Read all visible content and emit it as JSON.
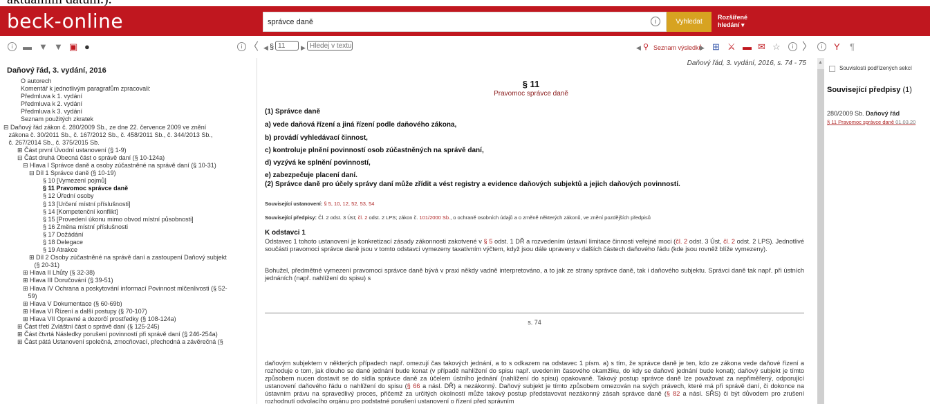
{
  "top_crop_text": "aktuálním datům.).",
  "header": {
    "logo": "beck-online",
    "search_value": "správce daně",
    "search_info": "i",
    "search_button": "Vyhledat",
    "advanced_line1": "Rozšířené",
    "advanced_line2": "hledání ▾"
  },
  "toolbar": {
    "left_icons": [
      "i",
      "▬",
      "▼",
      "▼",
      "▣",
      "●"
    ],
    "info": "i",
    "collapse": "〈",
    "prev": "◀",
    "section_symbol": "§",
    "section_input": "11",
    "next": "▶",
    "find_placeholder": "Hledej v textu",
    "result_prev": "◀",
    "results_label": "Seznam výsledků",
    "result_next": "▶",
    "right_icons": [
      "⊞",
      "⚔",
      "▬",
      "✉",
      "☆",
      "i"
    ],
    "expand": "〉",
    "right_info": "i",
    "filter": "Y",
    "bookmark": "¶"
  },
  "left": {
    "title": "Daňový řád, 3. vydání, 2016",
    "items": [
      {
        "indent": 0,
        "text": "O autorech"
      },
      {
        "indent": 0,
        "text": "Komentář k jednotlivým paragrafům zpracovali:"
      },
      {
        "indent": 0,
        "text": "Předmluva k 1. vydání"
      },
      {
        "indent": 0,
        "text": "Předmluva k 2. vydání"
      },
      {
        "indent": 0,
        "text": "Předmluva k 3. vydání"
      },
      {
        "indent": 0,
        "text": "Seznam použitých zkratek"
      },
      {
        "indent": -1,
        "text": "⊟ Daňový řád zákon č. 280/2009 Sb., ze dne 22. července 2009 ve znění\n   zákona č. 30/2011 Sb., č. 167/2012 Sb., č. 458/2011 Sb., č. 344/2013 Sb.,\n   č. 267/2014 Sb., č. 375/2015 Sb."
      },
      {
        "indent": 1,
        "text": "⊞ Část první Úvodní ustanovení (§ 1-9)"
      },
      {
        "indent": 1,
        "text": "⊟ Část druhá Obecná část o správě daní (§ 10-124a)"
      },
      {
        "indent": 2,
        "text": "⊟ Hlava I Správce daně a osoby zúčastněné na správě daní (§ 10-31)"
      },
      {
        "indent": 3,
        "text": "⊟ Díl 1 Správce daně (§ 10-19)"
      },
      {
        "indent": 4,
        "text": "§ 10 [Vymezení pojmů]"
      },
      {
        "indent": 4,
        "text": "§ 11 Pravomoc správce daně",
        "bold": true
      },
      {
        "indent": 4,
        "text": "§ 12 Úřední osoby"
      },
      {
        "indent": 4,
        "text": "§ 13 [Určení místní příslušnosti]"
      },
      {
        "indent": 4,
        "text": "§ 14 [Kompetenční konflikt]"
      },
      {
        "indent": 4,
        "text": "§ 15 [Provedení úkonu mimo obvod místní působnosti]"
      },
      {
        "indent": 4,
        "text": "§ 16 Změna místní příslušnosti"
      },
      {
        "indent": 4,
        "text": "§ 17 Dožádání"
      },
      {
        "indent": 4,
        "text": "§ 18 Delegace"
      },
      {
        "indent": 4,
        "text": "§ 19 Atrakce"
      },
      {
        "indent": 3,
        "text": "⊞ Díl 2 Osoby zúčastněné na správě daní a zastoupení Daňový subjekt\n   (§ 20-31)"
      },
      {
        "indent": 2,
        "text": "⊞ Hlava II Lhůty (§ 32-38)"
      },
      {
        "indent": 2,
        "text": "⊞ Hlava III Doručování (§ 39-51)"
      },
      {
        "indent": 2,
        "text": "⊞ Hlava IV Ochrana a poskytování informací Povinnost mlčenlivosti (§ 52-\n   59)"
      },
      {
        "indent": 2,
        "text": "⊞ Hlava V Dokumentace (§ 60-69b)"
      },
      {
        "indent": 2,
        "text": "⊞ Hlava VI Řízení a další postupy (§ 70-107)"
      },
      {
        "indent": 2,
        "text": "⊞ Hlava VII Opravné a dozorčí prostředky (§ 108-124a)"
      },
      {
        "indent": 1,
        "text": "⊞ Část třetí Zvláštní část o správě daní (§ 125-245)"
      },
      {
        "indent": 1,
        "text": "⊞ Část čtvrtá Následky porušení povinností při správě daní (§ 246-254a)"
      },
      {
        "indent": 1,
        "text": "⊞ Část pátá Ustanovení společná, zmocňovací, přechodná a závěrečná (§"
      }
    ]
  },
  "main": {
    "citation": "Daňový řád, 3. vydání, 2016, s. 74 - 75",
    "section_title": "§ 11",
    "section_subtitle": "Pravomoc správce daně",
    "paragraph1_heading": "(1) Správce daně",
    "points": [
      "a)   vede daňová řízení a jiná řízení podle daňového zákona,",
      "b)   provádí vyhledávací činnost,",
      "c)   kontroluje plnění povinností osob zúčastněných na správě daní,",
      "d)   vyzývá ke splnění povinností,",
      "e)   zabezpečuje placení daní."
    ],
    "paragraph2": "(2) Správce daně pro účely správy daní může zřídit a vést registry a evidence daňových subjektů a jejich daňových povinností.",
    "related_provisions_label": "Související ustanovení:",
    "related_provisions_links": "§ 5, 10, 12, 52, 53, 54",
    "related_regs_label": "Související předpisy:",
    "related_regs_t1": "Čl. 2 odst. 3 Úst;",
    "related_regs_l1": "čl. 2",
    "related_regs_t2": "odst. 2 LPS; zákon č.",
    "related_regs_l2": "101/2000 Sb.",
    "related_regs_t3": ", o ochraně osobních údajů a o změně některých zákonů, ve znění pozdějších předpisů",
    "k_odstavci_title": "K odstavci 1",
    "body1_a": "Odstavec 1 tohoto ustanovení je konkretizací zásady zákonnosti zakotvené v",
    "body1_l1": "§ 5",
    "body1_b": "odst. 1 DŘ a rozvedením ústavní limitace činnosti veřejné moci (",
    "body1_l2": "čl. 2",
    "body1_c": "odst. 3 Úst,",
    "body1_l3": "čl. 2",
    "body1_d": "odst. 2 LPS). Jednotlivé součásti pravomoci správce daně jsou v tomto odstavci vymezeny taxativním výčtem, když jsou dále upraveny v dalších částech daňového řádu (kde jsou rovněž blíže vymezeny).",
    "body2": "Bohužel, předmětné vymezení pravomoci správce daně bývá v praxi někdy vadně interpretováno, a to jak ze strany správce daně, tak i daňového subjektu. Správci daně tak např. při ústních jednáních (např. nahlížení do spisu) s",
    "page_number": "s. 74",
    "body3_a": "daňovým subjektem v některých případech např. omezují čas takových jednání, a to s odkazem na odstavec 1 písm. a) s tím, že správce daně je ten, kdo ze zákona vede daňové řízení a rozhoduje o tom, jak dlouho se dané jednání bude konat (v případě nahlížení do spisu např. uvedením časového okamžiku, do kdy se daňové jednání bude konat); daňový subjekt je tímto způsobem nucen dostavit se do sídla správce daně za účelem ústního jednání (nahlížení do spisu) opakovaně. Takový postup správce daně lze považovat za nepřiměřený, odporující ustanovení daňového řádu o nahlížení do spisu (",
    "body3_l1": "§ 66",
    "body3_b": "a násl. DŘ) a nezákonný. Daňový subjekt je tímto způsobem omezován na svých právech, které má při správě daní, či dokonce na ústavním právu na spravedlivý proces, přičemž za určitých okolností může takový postup představovat nezákonný zásah správce daně (",
    "body3_l2": "§ 82",
    "body3_c": "a násl. SŘS) či být důvodem pro zrušení rozhodnutí odvolacího orgánu pro podstatné porušení ustanovení o řízení před správním"
  },
  "right": {
    "checkbox_label": "Souvislosti podřízených sekcí",
    "related_title": "Související předpisy",
    "related_count": "(1)",
    "act": "280/2009 Sb.",
    "act_name": "Daňový řád",
    "link": "§ 11 Pravomoc správce daně",
    "link_date": "01.03.20"
  },
  "colors": {
    "brand_red": "#c0171f",
    "button_gold": "#d7a321",
    "link_red": "#b02a2a"
  }
}
